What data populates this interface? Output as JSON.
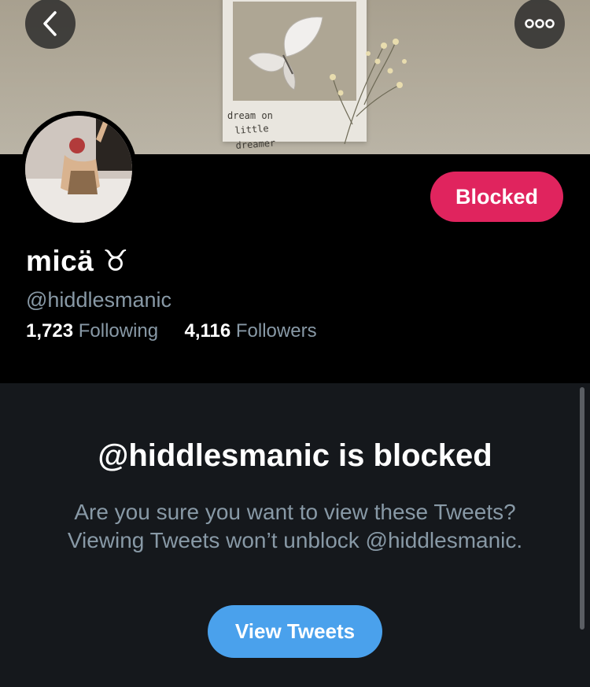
{
  "header": {
    "back_icon": "chevron-left-icon",
    "more_icon": "more-dots-icon",
    "banner_caption_line1": "dream on",
    "banner_caption_line2": "little dreamer"
  },
  "profile": {
    "display_name": "micä ♉︎",
    "handle": "@hiddlesmanic",
    "following_count": "1,723",
    "following_label": "Following",
    "followers_count": "4,116",
    "followers_label": "Followers",
    "blocked_button_label": "Blocked"
  },
  "blocked_notice": {
    "title": "@hiddlesmanic is blocked",
    "message": "Are you sure you want to view these Tweets? Viewing Tweets won’t unblock @hiddlesmanic.",
    "view_button_label": "View Tweets"
  },
  "colors": {
    "blocked_button": "#e0245e",
    "view_button": "#4aa1ec",
    "secondary_text": "#8899a6",
    "panel_background": "#15181c"
  }
}
